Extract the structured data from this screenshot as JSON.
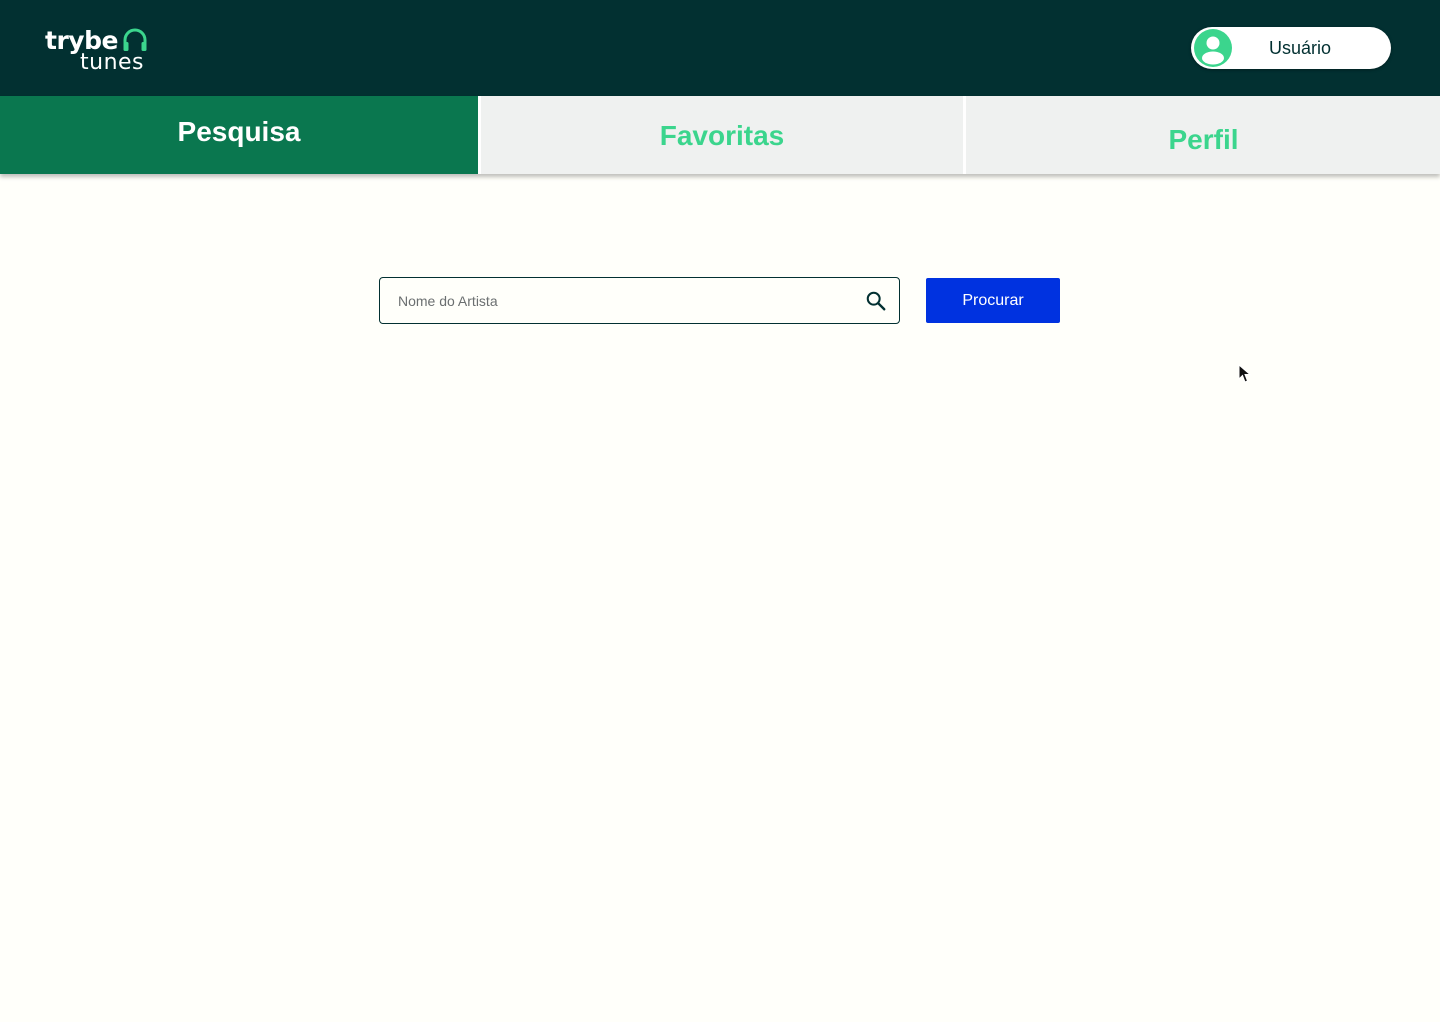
{
  "brand": {
    "name_top": "trybe",
    "name_bottom": "tunes",
    "icon": "headphones-icon",
    "accent_color": "#3bd58d",
    "header_color": "#023031"
  },
  "user": {
    "name": "Usuário",
    "avatar_icon": "user-avatar-icon"
  },
  "tabs": [
    {
      "label": "Pesquisa",
      "active": true
    },
    {
      "label": "Favoritas",
      "active": false
    },
    {
      "label": "Perfil",
      "active": false
    }
  ],
  "search": {
    "placeholder": "Nome do Artista",
    "value": "",
    "icon": "search-icon",
    "button_label": "Procurar",
    "button_color": "#0032e0"
  },
  "colors": {
    "active_tab": "#0a774f",
    "inactive_tab_text": "#3bd58d",
    "background": "#fffffa"
  }
}
